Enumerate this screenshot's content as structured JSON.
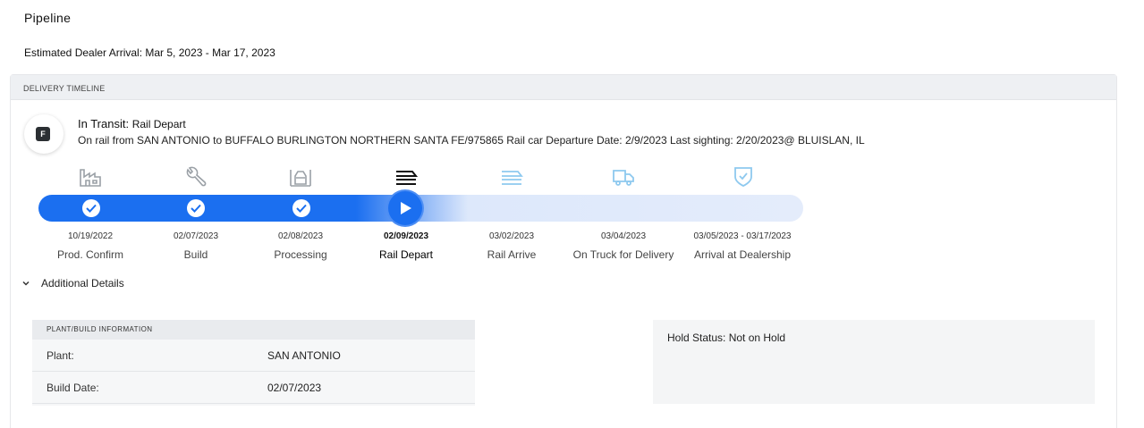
{
  "page": {
    "title": "Pipeline",
    "estimated_arrival": "Estimated Dealer Arrival: Mar 5, 2023 - Mar 17, 2023"
  },
  "timeline": {
    "header": "DELIVERY TIMELINE",
    "status_badge_letter": "F",
    "status_prefix": "In Transit:",
    "status_value": "Rail Depart",
    "status_detail": "On rail from SAN ANTONIO to BUFFALO BURLINGTON NORTHERN SANTA FE/975865 Rail car Departure Date: 2/9/2023 Last sighting: 2/20/2023@ BLUISLAN, IL",
    "progress_steps_completed": 4,
    "progress_steps_total": 7,
    "active_step": "Rail Depart",
    "colors": {
      "progress": "#1b6ff0",
      "track": "#e4ecfb",
      "icon_inactive": "#9aa0a6",
      "icon_future": "#8ec9ef"
    },
    "steps": [
      {
        "date": "10/19/2022",
        "label": "Prod. Confirm",
        "icon": "factory-icon",
        "state": "done"
      },
      {
        "date": "02/07/2023",
        "label": "Build",
        "icon": "wrench-icon",
        "state": "done"
      },
      {
        "date": "02/08/2023",
        "label": "Processing",
        "icon": "processing-icon",
        "state": "done"
      },
      {
        "date": "02/09/2023",
        "label": "Rail Depart",
        "icon": "rail-icon",
        "state": "current"
      },
      {
        "date": "03/02/2023",
        "label": "Rail Arrive",
        "icon": "rail-icon",
        "state": "future"
      },
      {
        "date": "03/04/2023",
        "label": "On Truck for Delivery",
        "icon": "truck-icon",
        "state": "future"
      },
      {
        "date": "03/05/2023 - 03/17/2023",
        "label": "Arrival at Dealership",
        "icon": "shield-check-icon",
        "state": "future"
      }
    ]
  },
  "details": {
    "toggle_label": "Additional Details",
    "plant_header": "PLANT/BUILD INFORMATION",
    "rows": [
      {
        "key": "Plant:",
        "value": "SAN ANTONIO"
      },
      {
        "key": "Build Date:",
        "value": "02/07/2023"
      }
    ],
    "hold_status": "Hold Status: Not on Hold"
  }
}
